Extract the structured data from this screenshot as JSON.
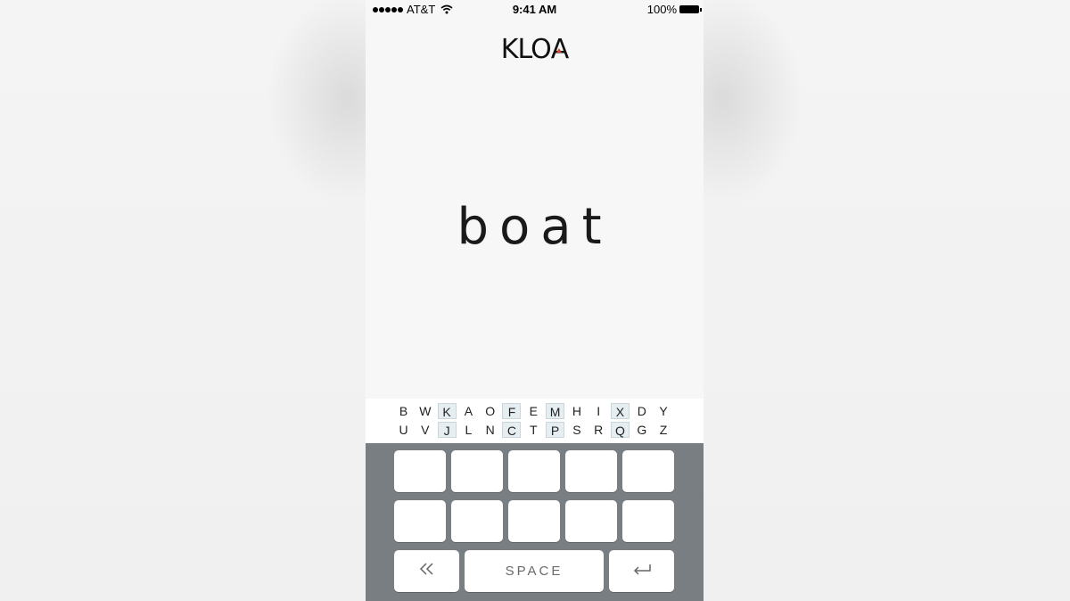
{
  "status_bar": {
    "carrier": "AT&T",
    "time": "9:41 AM",
    "battery": "100%"
  },
  "logo": {
    "text_before": "KLO",
    "text_mark_letter": "A",
    "mark_color": "#d3472e"
  },
  "word": "boat",
  "letter_strip": {
    "row1": [
      {
        "ch": "B",
        "hl": false
      },
      {
        "ch": "W",
        "hl": false
      },
      {
        "ch": "K",
        "hl": true
      },
      {
        "ch": "A",
        "hl": false
      },
      {
        "ch": "O",
        "hl": false
      },
      {
        "ch": "F",
        "hl": true
      },
      {
        "ch": "E",
        "hl": false
      },
      {
        "ch": "M",
        "hl": true
      },
      {
        "ch": "H",
        "hl": false
      },
      {
        "ch": "I",
        "hl": false
      },
      {
        "ch": "X",
        "hl": true
      },
      {
        "ch": "D",
        "hl": false
      },
      {
        "ch": "Y",
        "hl": false
      }
    ],
    "row2": [
      {
        "ch": "U",
        "hl": false
      },
      {
        "ch": "V",
        "hl": false
      },
      {
        "ch": "J",
        "hl": true
      },
      {
        "ch": "L",
        "hl": false
      },
      {
        "ch": "N",
        "hl": false
      },
      {
        "ch": "C",
        "hl": true
      },
      {
        "ch": "T",
        "hl": false
      },
      {
        "ch": "P",
        "hl": true
      },
      {
        "ch": "S",
        "hl": false
      },
      {
        "ch": "R",
        "hl": false
      },
      {
        "ch": "Q",
        "hl": true
      },
      {
        "ch": "G",
        "hl": false
      },
      {
        "ch": "Z",
        "hl": false
      }
    ]
  },
  "keypad": {
    "blank_key_count": 10,
    "space_label": "SPACE",
    "backspace_icon": "double-chevron-left-icon",
    "return_icon": "return-arrow-icon",
    "background": "#797e83"
  }
}
